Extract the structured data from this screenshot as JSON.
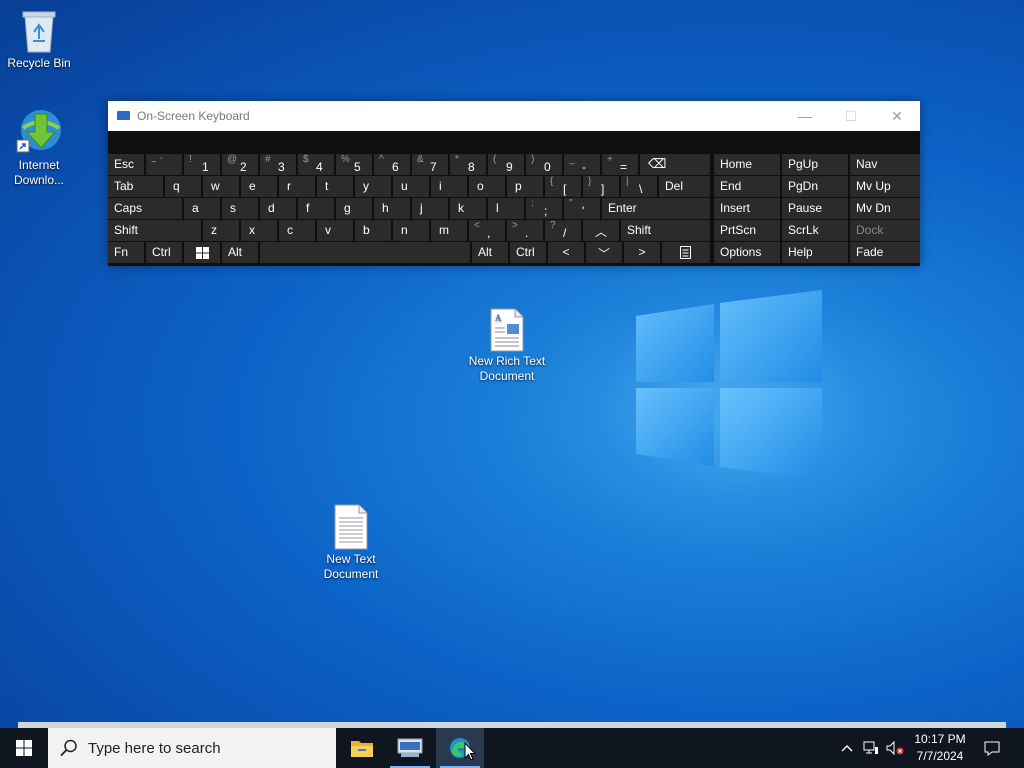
{
  "desktop": {
    "icons": [
      {
        "label": "Recycle Bin",
        "icon": "recycle-bin-icon"
      },
      {
        "label": "Internet Downlo...",
        "icon": "internet-download-manager-icon"
      },
      {
        "label": "New Rich Text Document",
        "icon": "rich-text-document-icon"
      },
      {
        "label": "New Text Document",
        "icon": "text-document-icon"
      }
    ]
  },
  "osk": {
    "title": "On-Screen Keyboard",
    "controls": {
      "minimize": "—",
      "maximize": "☐",
      "close": "✕"
    },
    "rows": {
      "row1": {
        "esc": "Esc",
        "tilde": {
          "sec": "~ `",
          "pri": ""
        },
        "k1": {
          "sec": "!",
          "pri": "1"
        },
        "k2": {
          "sec": "@",
          "pri": "2"
        },
        "k3": {
          "sec": "#",
          "pri": "3"
        },
        "k4": {
          "sec": "$",
          "pri": "4"
        },
        "k5": {
          "sec": "%",
          "pri": "5"
        },
        "k6": {
          "sec": "^",
          "pri": "6"
        },
        "k7": {
          "sec": "&",
          "pri": "7"
        },
        "k8": {
          "sec": "*",
          "pri": "8"
        },
        "k9": {
          "sec": "(",
          "pri": "9"
        },
        "k0": {
          "sec": ")",
          "pri": "0"
        },
        "minus": {
          "sec": "_",
          "pri": "-"
        },
        "equals": {
          "sec": "+",
          "pri": "="
        },
        "backspace": "⌫",
        "home": "Home",
        "pgup": "PgUp",
        "nav": "Nav"
      },
      "row2": {
        "tab": "Tab",
        "letters": [
          "q",
          "w",
          "e",
          "r",
          "t",
          "y",
          "u",
          "i",
          "o",
          "p"
        ],
        "lbracket": {
          "sec": "{",
          "pri": "["
        },
        "rbracket": {
          "sec": "}",
          "pri": "]"
        },
        "backslash": {
          "sec": "|",
          "pri": "\\"
        },
        "del": "Del",
        "end": "End",
        "pgdn": "PgDn",
        "mvup": "Mv Up"
      },
      "row3": {
        "caps": "Caps",
        "letters": [
          "a",
          "s",
          "d",
          "f",
          "g",
          "h",
          "j",
          "k",
          "l"
        ],
        "semicolon": {
          "sec": ":",
          "pri": ";"
        },
        "quote": {
          "sec": "\"",
          "pri": "'"
        },
        "enter": "Enter",
        "insert": "Insert",
        "pause": "Pause",
        "mvdn": "Mv Dn"
      },
      "row4": {
        "shift_left": "Shift",
        "letters": [
          "z",
          "x",
          "c",
          "v",
          "b",
          "n",
          "m"
        ],
        "comma": {
          "sec": "<",
          "pri": ","
        },
        "period": {
          "sec": ">",
          "pri": "."
        },
        "slash": {
          "sec": "?",
          "pri": "/"
        },
        "up": "︿",
        "shift_right": "Shift",
        "prtscn": "PrtScn",
        "scrlk": "ScrLk",
        "dock": "Dock"
      },
      "row5": {
        "fn": "Fn",
        "ctrl_left": "Ctrl",
        "win": "windows-logo-icon",
        "alt_left": "Alt",
        "alt_right": "Alt",
        "ctrl_right": "Ctrl",
        "left": "<",
        "down": "﹀",
        "right": ">",
        "menu": "menu-icon",
        "options": "Options",
        "help": "Help",
        "fade": "Fade"
      }
    }
  },
  "taskbar": {
    "search_placeholder": "Type here to search",
    "apps": [
      "file-explorer-icon",
      "on-screen-keyboard-icon",
      "edge-icon"
    ],
    "clock": {
      "time": "10:17 PM",
      "date": "7/7/2024"
    },
    "tray": [
      "chevron-up-icon",
      "network-icon",
      "volume-muted-icon",
      "notification-icon"
    ]
  },
  "colors": {
    "accent": "#0a63c9",
    "osk_key": "#2b2b2b",
    "taskbar": "#0f1620"
  }
}
